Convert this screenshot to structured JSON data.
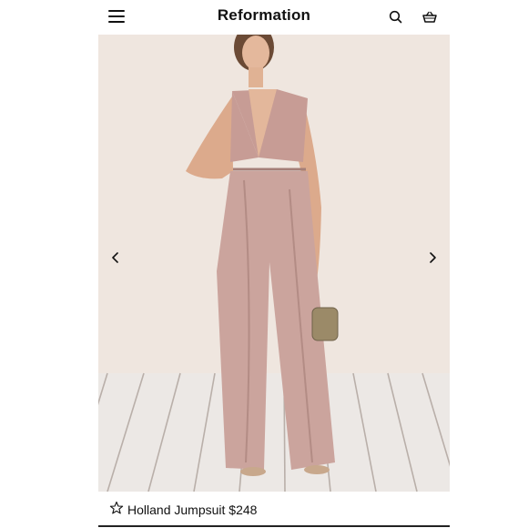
{
  "header": {
    "brand": "Reformation",
    "menu_icon": "hamburger-menu-icon",
    "search_icon": "search-icon",
    "bag_icon": "shopping-basket-icon"
  },
  "gallery": {
    "image_subject": "model wearing mauve velvet jumpsuit holding gold clutch",
    "prev_icon": "chevron-left-icon",
    "next_icon": "chevron-right-icon"
  },
  "product": {
    "favorite_icon": "star-outline-icon",
    "name": "Holland Jumpsuit",
    "price": "$248"
  },
  "colors": {
    "text": "#111111",
    "photo_background": "#efe6df",
    "floor": "#ede9e6",
    "garment": "#c9a39c"
  }
}
